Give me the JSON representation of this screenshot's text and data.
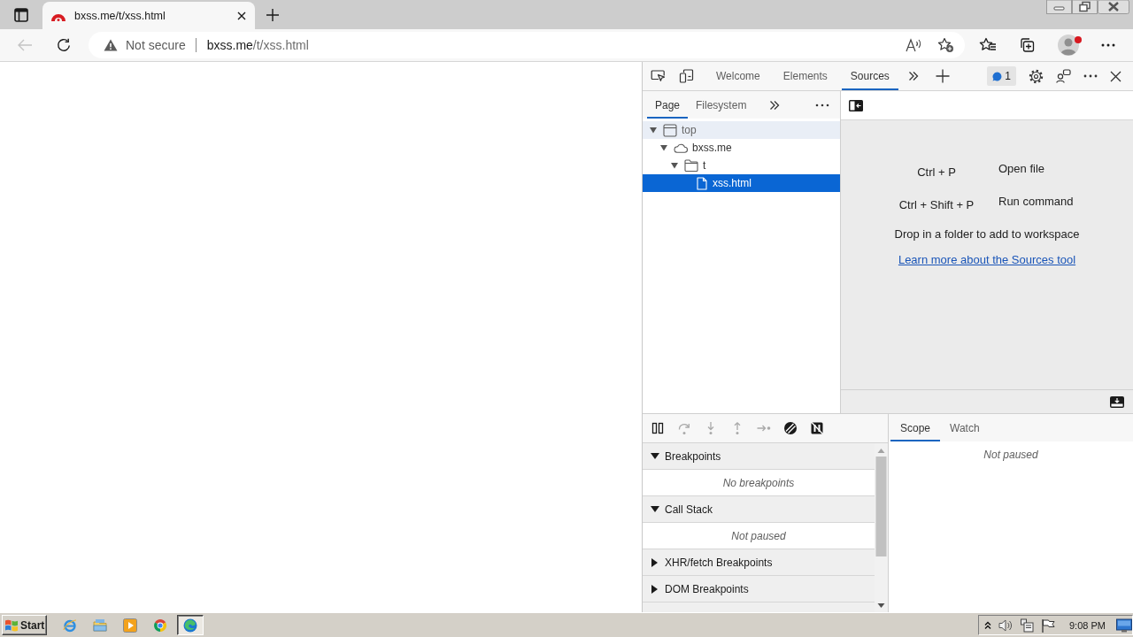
{
  "browser": {
    "tabs": [
      {
        "title": "bxss.me/t/xss.html",
        "selected": true
      }
    ],
    "back_button": {
      "disabled": true
    },
    "address_bar": {
      "security_label": "Not secure",
      "url_host": "bxss.me",
      "url_path": "/t/xss.html"
    },
    "profile": {
      "notification": true
    }
  },
  "devtools": {
    "tabs": [
      {
        "label": "Welcome",
        "selected": false
      },
      {
        "label": "Elements",
        "selected": false
      },
      {
        "label": "Sources",
        "selected": true
      }
    ],
    "issues_count": "1",
    "navigator": {
      "tabs": [
        {
          "label": "Page",
          "selected": true
        },
        {
          "label": "Filesystem",
          "selected": false
        }
      ],
      "tree": [
        {
          "label": "top",
          "kind": "frame",
          "expanded": true,
          "selected": false,
          "hovered": true,
          "children": [
            {
              "label": "bxss.me",
              "kind": "domain",
              "expanded": true,
              "selected": false,
              "hovered": false,
              "children": [
                {
                  "label": "t",
                  "kind": "folder",
                  "expanded": true,
                  "selected": false,
                  "hovered": false,
                  "children": [
                    {
                      "label": "xss.html",
                      "kind": "file",
                      "selected": true,
                      "hovered": false
                    }
                  ]
                }
              ]
            }
          ]
        }
      ]
    },
    "editor": {
      "shortcuts": [
        {
          "keys": "Ctrl + P",
          "action": "Open file"
        },
        {
          "keys": "Ctrl + Shift + P",
          "action": "Run command"
        }
      ],
      "hint": "Drop in a folder to add to workspace",
      "link": "Learn more about the Sources tool"
    },
    "debugger": {
      "toolbar": [
        {
          "kind": "pause",
          "disabled": false
        },
        {
          "kind": "step-over",
          "disabled": true
        },
        {
          "kind": "step-into",
          "disabled": true
        },
        {
          "kind": "step-out",
          "disabled": true
        },
        {
          "kind": "step",
          "disabled": true
        },
        {
          "kind": "deactivate-breakpoints",
          "disabled": false
        },
        {
          "kind": "pause-on-exceptions",
          "disabled": false
        }
      ],
      "sections": [
        {
          "title": "Breakpoints",
          "expanded": true,
          "message": "No breakpoints"
        },
        {
          "title": "Call Stack",
          "expanded": true,
          "message": "Not paused"
        },
        {
          "title": "XHR/fetch Breakpoints",
          "expanded": false
        },
        {
          "title": "DOM Breakpoints",
          "expanded": false
        }
      ],
      "sidebar": {
        "tabs": [
          {
            "label": "Scope",
            "selected": true
          },
          {
            "label": "Watch",
            "selected": false
          }
        ],
        "message": "Not paused"
      }
    }
  },
  "taskbar": {
    "start_label": "Start",
    "apps": [
      {
        "kind": "ie",
        "selected": false
      },
      {
        "kind": "explorer",
        "selected": false
      },
      {
        "kind": "media",
        "selected": false
      },
      {
        "kind": "chrome",
        "selected": false
      },
      {
        "kind": "edge",
        "selected": true
      }
    ],
    "clock": "9:08 PM"
  }
}
